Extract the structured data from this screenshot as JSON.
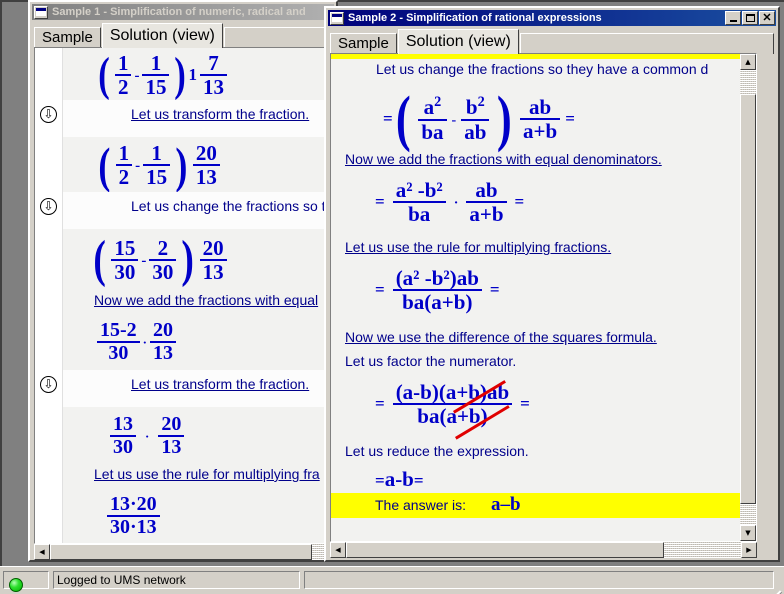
{
  "app": {
    "statusbar": {
      "led_color": "#00d000",
      "message": "Logged to UMS network"
    }
  },
  "window1": {
    "title": "Sample 1 - Simplification of numeric, radical and",
    "active": false,
    "tabs": [
      {
        "label": "Sample",
        "selected": false
      },
      {
        "label": "Solution (view)",
        "selected": true
      }
    ],
    "lines": [
      {
        "kind": "math",
        "marker": false,
        "expr": "( 1/2 - 1/15 ) 1 7/13",
        "parts": {
          "n1": "1",
          "d1": "2",
          "n2": "1",
          "d2": "15",
          "whole": "1",
          "n3": "7",
          "d3": "13",
          "op": "-"
        }
      },
      {
        "kind": "hint",
        "marker": true,
        "text": "Let us transform the fraction."
      },
      {
        "kind": "math",
        "marker": false,
        "expr": "( 1/2 - 1/15 ) 20/13",
        "parts": {
          "n1": "1",
          "d1": "2",
          "n2": "1",
          "d2": "15",
          "n3": "20",
          "d3": "13",
          "op": "-"
        }
      },
      {
        "kind": "plain",
        "marker": true,
        "text": "Let us change the fractions so the"
      },
      {
        "kind": "math",
        "marker": false,
        "expr": "( 15/30 - 2/30 ) 20/13",
        "parts": {
          "n1": "15",
          "d1": "30",
          "n2": "2",
          "d2": "30",
          "n3": "20",
          "d3": "13",
          "op": "-"
        }
      },
      {
        "kind": "hint",
        "marker": false,
        "text": "Now we add the fractions with equal"
      },
      {
        "kind": "math",
        "marker": false,
        "expr": "(15-2)/30 . 20/13",
        "parts": {
          "n1": "15-2",
          "d1": "30",
          "n2": "20",
          "d2": "13",
          "op": "·"
        }
      },
      {
        "kind": "hint",
        "marker": true,
        "text": "Let us transform the fraction."
      },
      {
        "kind": "math",
        "marker": false,
        "expr": "13/30 . 20/13",
        "parts": {
          "n1": "13",
          "d1": "30",
          "n2": "20",
          "d2": "13",
          "op": "·"
        }
      },
      {
        "kind": "hint",
        "marker": false,
        "text": "Let us use the rule for multiplying fra"
      },
      {
        "kind": "math",
        "marker": false,
        "expr": "(13.20)/(30.13)",
        "parts": {
          "n1": "13·20",
          "d1": "30·13"
        }
      }
    ],
    "hscroll": {
      "position": "left"
    }
  },
  "window2": {
    "title": "Sample 2 - Simplification of rational expressions",
    "active": true,
    "titlebar_buttons": [
      {
        "name": "minimize",
        "glyph": "_"
      },
      {
        "name": "maximize",
        "glyph": "□"
      },
      {
        "name": "close",
        "glyph": "✕"
      }
    ],
    "tabs": [
      {
        "label": "Sample",
        "selected": false
      },
      {
        "label": "Solution (view)",
        "selected": true
      }
    ],
    "lines": [
      {
        "kind": "plain",
        "text": "Let us change the fractions so they have a common d"
      },
      {
        "kind": "math",
        "expr": "= ( a²/ba - b²/ab ) ab/(a+b) =",
        "parts": {
          "n1": "a",
          "sup1": "2",
          "d1": "ba",
          "n2": "b",
          "sup2": "2",
          "d2": "ab",
          "n3": "ab",
          "d3": "a+b"
        }
      },
      {
        "kind": "hint",
        "text": "Now we add the fractions with equal denominators."
      },
      {
        "kind": "math",
        "expr": "= (a²-b²)/ba · ab/(a+b) =",
        "parts": {
          "num": "a² -b²",
          "den": "ba",
          "n2": "ab",
          "d2": "a+b"
        }
      },
      {
        "kind": "hint",
        "text": "Let us use the rule for multiplying fractions."
      },
      {
        "kind": "math",
        "expr": "= ((a²-b²)ab)/(ba(a+b)) =",
        "parts": {
          "num": "(a² -b²)ab",
          "den": "ba(a+b)"
        }
      },
      {
        "kind": "hint",
        "text": "Now we use the difference of the squares formula."
      },
      {
        "kind": "plain",
        "text": "Let us factor the numerator."
      },
      {
        "kind": "math",
        "expr": "= ((a-b)(a+b)ab)/(ba(a+b)) =",
        "parts": {
          "num": "(a-b)(a+b)ab",
          "den": "ba(a+b)"
        },
        "struck": true
      },
      {
        "kind": "plain",
        "text": "Let us reduce the expression."
      },
      {
        "kind": "math",
        "expr": "= a - b =",
        "parts": {
          "value": "a-b"
        }
      }
    ],
    "answer_bar": {
      "label": "The answer is:",
      "value": "a–b",
      "background": "#ffff00"
    },
    "vscroll": {
      "up": "▲",
      "down": "▼"
    },
    "hscroll": {
      "left": "◀",
      "right": "▶"
    }
  },
  "colors": {
    "math": "#0000c8",
    "text": "#00008b",
    "strike": "#e00000",
    "highlight": "#ffff00",
    "titlebar_active": "#00007b",
    "titlebar_inactive": "#808080",
    "face": "#d4d0c8"
  }
}
